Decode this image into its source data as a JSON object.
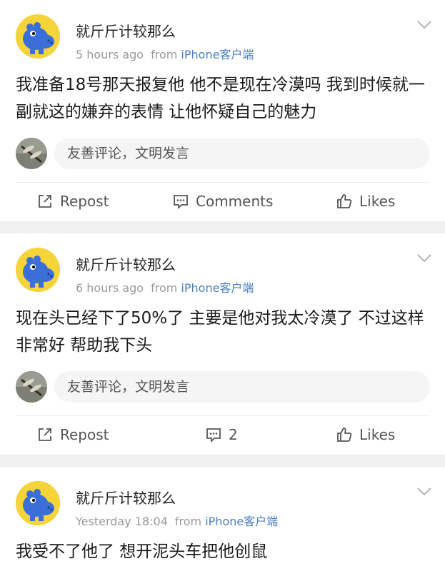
{
  "posts": [
    {
      "author": "就斤斤计较那么",
      "time": "5 hours ago",
      "source_prefix": "from",
      "device": "iPhone客户端",
      "text": "我准备18号那天报复他 他不是现在冷漠吗 我到时候就一副就这的嫌弃的表情 让他怀疑自己的魅力",
      "comment_placeholder": "友善评论，文明发言",
      "repost_label": "Repost",
      "comments_label": "Comments",
      "likes_label": "Likes"
    },
    {
      "author": "就斤斤计较那么",
      "time": "6 hours ago",
      "source_prefix": "from",
      "device": "iPhone客户端",
      "text": "现在头已经下了50%了 主要是他对我太冷漠了 不过这样非常好 帮助我下头",
      "comment_placeholder": "友善评论，文明发言",
      "repost_label": "Repost",
      "comments_label": "2",
      "likes_label": "Likes"
    },
    {
      "author": "就斤斤计较那么",
      "time": "Yesterday 18:04",
      "source_prefix": "from",
      "device": "iPhone客户端",
      "text": "我受不了他了 想开泥头车把他创鼠"
    }
  ],
  "colors": {
    "link_blue": "#4a7fc0",
    "meta_gray": "#9a9a9a",
    "avatar_yellow": "#f5d43a",
    "avatar_blue": "#3a6fd8"
  },
  "icons": [
    "hippo-avatar-icon",
    "chevron-down-icon",
    "repost-icon",
    "comment-icon",
    "like-icon"
  ]
}
